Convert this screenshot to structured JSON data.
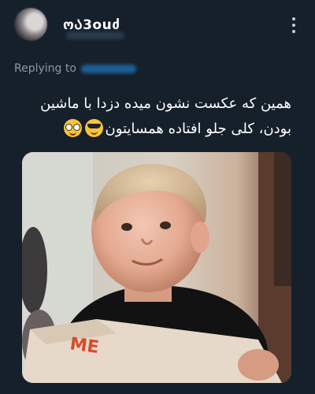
{
  "tweet": {
    "display_name": "ოᲐ3ouძ",
    "replying_label": "Replying to",
    "text_line1": "همین که عکست نشون میده دزدا با ماشین",
    "text_line2": "بودن، کلی جلو افتاده همسایتون",
    "emojis": [
      "nerd-face-emoji",
      "smiling-face-sunglasses-emoji"
    ],
    "photo_box_text": "ME"
  },
  "colors": {
    "background": "#15202b",
    "secondary_text": "#8b98a5",
    "accent": "#1d9bf0"
  }
}
